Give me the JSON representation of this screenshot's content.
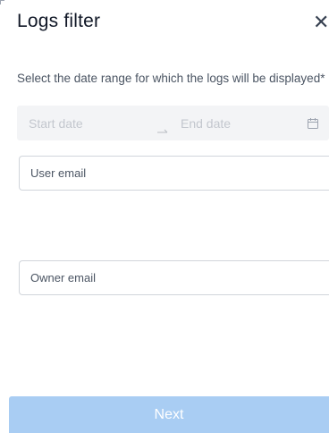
{
  "modal": {
    "title": "Logs filter",
    "close_icon": "close-icon",
    "close_glyph": "✕"
  },
  "date_range": {
    "instruction": "Select the date range for which the logs will be displayed*",
    "start_placeholder": "Start date",
    "end_placeholder": "End date",
    "separator_icon": "arrow-right-icon",
    "calendar_icon": "calendar-icon"
  },
  "user_email": {
    "placeholder": "User email",
    "value": ""
  },
  "owner_email": {
    "placeholder": "Owner email",
    "value": ""
  },
  "actions": {
    "next_label": "Next"
  },
  "colors": {
    "next_button_bg": "#a9cdf3",
    "range_bg": "#f3f4f6",
    "field_border": "#d1d5db"
  }
}
